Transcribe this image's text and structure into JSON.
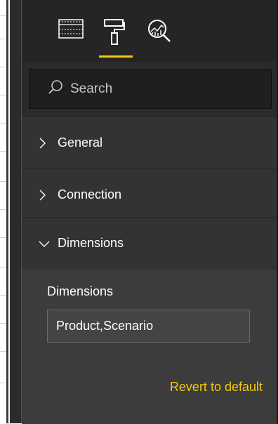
{
  "tabs": [
    {
      "name": "fields",
      "icon": "table-grid-icon",
      "active": false
    },
    {
      "name": "format",
      "icon": "paint-roller-icon",
      "active": true
    },
    {
      "name": "analytics",
      "icon": "analytics-magnifier-icon",
      "active": false
    }
  ],
  "accent_color": "#f2c811",
  "search": {
    "placeholder": "Search",
    "value": ""
  },
  "sections": [
    {
      "label": "General",
      "expanded": false
    },
    {
      "label": "Connection",
      "expanded": false
    },
    {
      "label": "Dimensions",
      "expanded": true
    }
  ],
  "dimensions_panel": {
    "field_label": "Dimensions",
    "field_value": "Product,Scenario",
    "revert_label": "Revert to default"
  }
}
